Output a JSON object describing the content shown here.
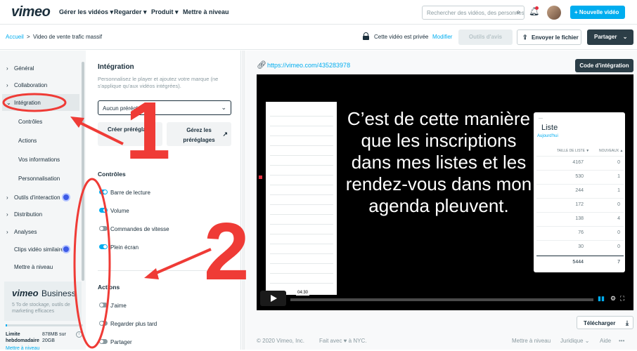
{
  "topnav": {
    "logo": "vimeo",
    "items": [
      "Gérer les vidéos",
      "Regarder",
      "Produit",
      "Mettre à niveau"
    ],
    "search_placeholder": "Rechercher des vidéos, des personnes",
    "new_video": "+ Nouvelle vidéo"
  },
  "subbar": {
    "breadcrumb_home": "Accueil",
    "breadcrumb_sep": ">",
    "breadcrumb_title": "Video de vente trafic massif",
    "privacy": "Cette vidéo est privée",
    "modify": "Modifier",
    "review": "Outils d'avis",
    "send": "Envoyer le fichier",
    "share": "Partager"
  },
  "sidebar": {
    "items": [
      "Général",
      "Collaboration",
      "Intégration",
      "Contrôles",
      "Actions",
      "Vos informations",
      "Personnalisation",
      "Outils d'interaction",
      "Distribution",
      "Analyses",
      "Clips vidéo similaires",
      "Mettre à niveau"
    ],
    "business_logo": "vimeo",
    "business_word": "Business",
    "business_text": "5 To de stockage, outils de marketing efficaces",
    "storage_label": "Limite hebdomadaire",
    "storage_value": "878MB sur 20GB",
    "upgrade": "Mettre à niveau"
  },
  "settings": {
    "title": "Intégration",
    "description": "Personnalisez le player et ajoutez votre marque (ne s'applique qu'aux vidéos intégrées).",
    "preset_value": "Aucun préréglage",
    "create_preset": "Créer préréglage",
    "manage_presets": "Gérez les préréglages",
    "controls_title": "Contrôles",
    "controls": [
      {
        "label": "Barre de lecture",
        "on": true
      },
      {
        "label": "Volume",
        "on": true
      },
      {
        "label": "Commandes de vitesse",
        "on": false
      },
      {
        "label": "Plein écran",
        "on": true
      }
    ],
    "actions_title": "Actions",
    "actions": [
      {
        "label": "J'aime",
        "on": false
      },
      {
        "label": "Regarder plus tard",
        "on": false
      },
      {
        "label": "Partager",
        "on": false
      }
    ]
  },
  "video": {
    "url": "https://vimeo.com/435283978",
    "embed_code": "Code d'intégration",
    "caption": "C’est de cette manière que les inscriptions dans mes listes et les rendez-vous dans mon agenda pleuvent.",
    "list_title": "Liste",
    "list_sub": "Aujourd'hui",
    "col1": "TAILLE DE LISTE ▼",
    "col2": "NOUVEAUX ▲",
    "rows": [
      [
        "4167",
        "0"
      ],
      [
        "530",
        "1"
      ],
      [
        "244",
        "1"
      ],
      [
        "172",
        "0"
      ],
      [
        "138",
        "4"
      ],
      [
        "76",
        "0"
      ],
      [
        "30",
        "0"
      ]
    ],
    "total": [
      "5444",
      "7"
    ],
    "time": "04:30",
    "progress": 0.01,
    "download": "Télécharger"
  },
  "footer": {
    "copyright": "© 2020 Vimeo, Inc.",
    "made": "Fait avec ♥ à NYC.",
    "upgrade": "Mettre à niveau",
    "legal": "Juridique",
    "help": "Aide",
    "more": "•••"
  },
  "annotations": {
    "one": "1",
    "two": "2"
  },
  "colors": {
    "accent": "#00adef",
    "dark": "#2c3e47",
    "annotation": "#ef3b36"
  }
}
